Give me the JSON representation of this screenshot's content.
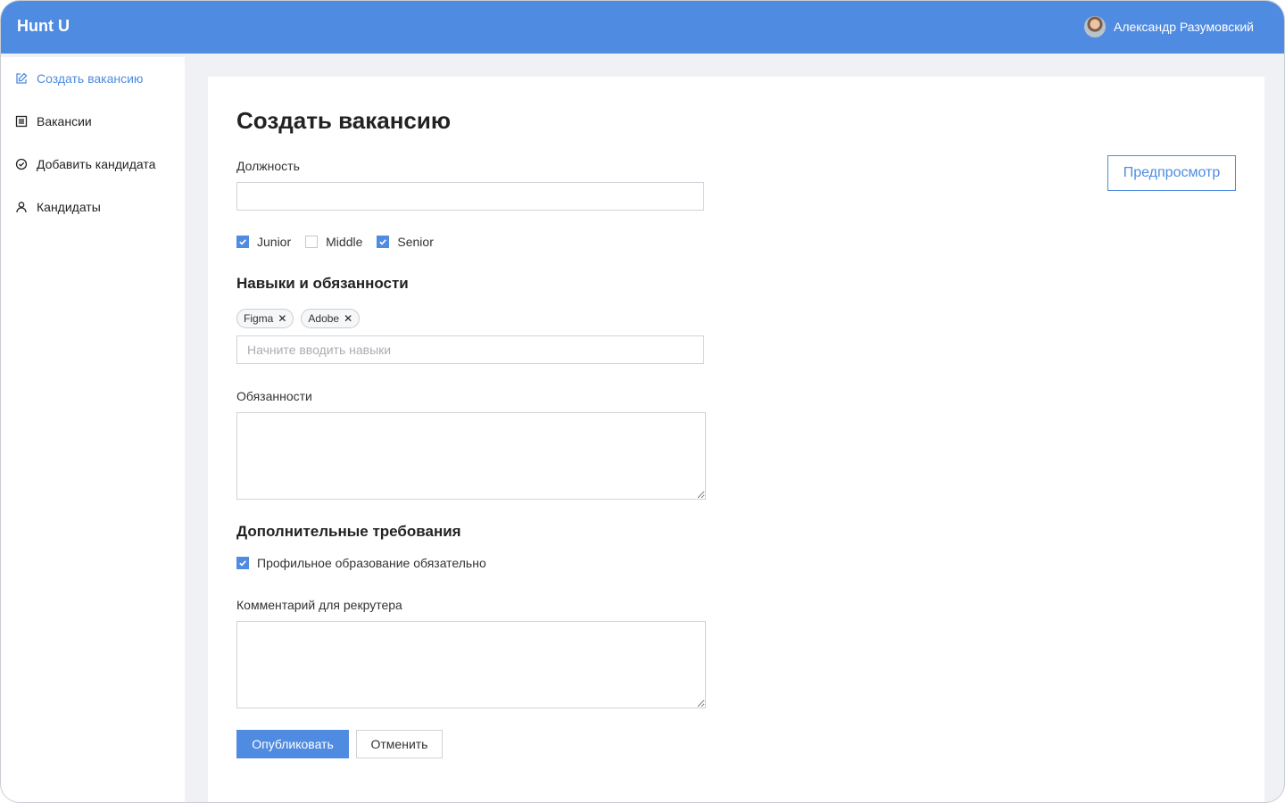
{
  "app": {
    "brand": "Hunt U",
    "user_name": "Александр Разумовский",
    "accent": "#4f8be0"
  },
  "sidebar": {
    "items": [
      {
        "label": "Создать вакансию",
        "icon": "edit-icon",
        "active": true
      },
      {
        "label": "Вакансии",
        "icon": "list-icon",
        "active": false
      },
      {
        "label": "Добавить кандидата",
        "icon": "check-circle-icon",
        "active": false
      },
      {
        "label": "Кандидаты",
        "icon": "user-icon",
        "active": false
      }
    ]
  },
  "form": {
    "title": "Создать вакансию",
    "position_label": "Должность",
    "position_value": "",
    "levels": [
      {
        "label": "Junior",
        "checked": true
      },
      {
        "label": "Middle",
        "checked": false
      },
      {
        "label": "Senior",
        "checked": true
      }
    ],
    "skills_heading": "Навыки и обязанности",
    "skill_tags": [
      "Figma",
      "Adobe"
    ],
    "skills_placeholder": "Начните вводить навыки",
    "duties_label": "Обязанности",
    "extra_heading": "Дополнительные требования",
    "education_label": "Профильное образование обязательно",
    "education_checked": true,
    "comment_label": "Комментарий для рекрутера",
    "publish_label": "Опубликовать",
    "cancel_label": "Отменить",
    "preview_label": "Предпросмотр"
  }
}
